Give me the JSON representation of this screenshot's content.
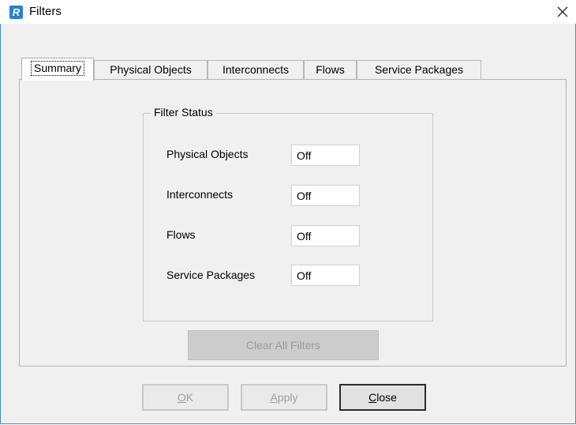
{
  "window": {
    "title": "Filters",
    "app_icon_letter": "R",
    "accent_color": "#2a7fd4"
  },
  "tabs": [
    {
      "label": "Summary",
      "active": true
    },
    {
      "label": "Physical Objects",
      "active": false
    },
    {
      "label": "Interconnects",
      "active": false
    },
    {
      "label": "Flows",
      "active": false
    },
    {
      "label": "Service Packages",
      "active": false
    }
  ],
  "filter_status": {
    "legend": "Filter Status",
    "rows": [
      {
        "label": "Physical Objects",
        "value": "Off"
      },
      {
        "label": "Interconnects",
        "value": "Off"
      },
      {
        "label": "Flows",
        "value": "Off"
      },
      {
        "label": "Service Packages",
        "value": "Off"
      }
    ]
  },
  "buttons": {
    "clear_all": "Clear All Filters",
    "ok_first": "O",
    "ok_rest": "K",
    "apply_first": "A",
    "apply_rest": "pply",
    "close_first": "C",
    "close_rest": "lose"
  }
}
